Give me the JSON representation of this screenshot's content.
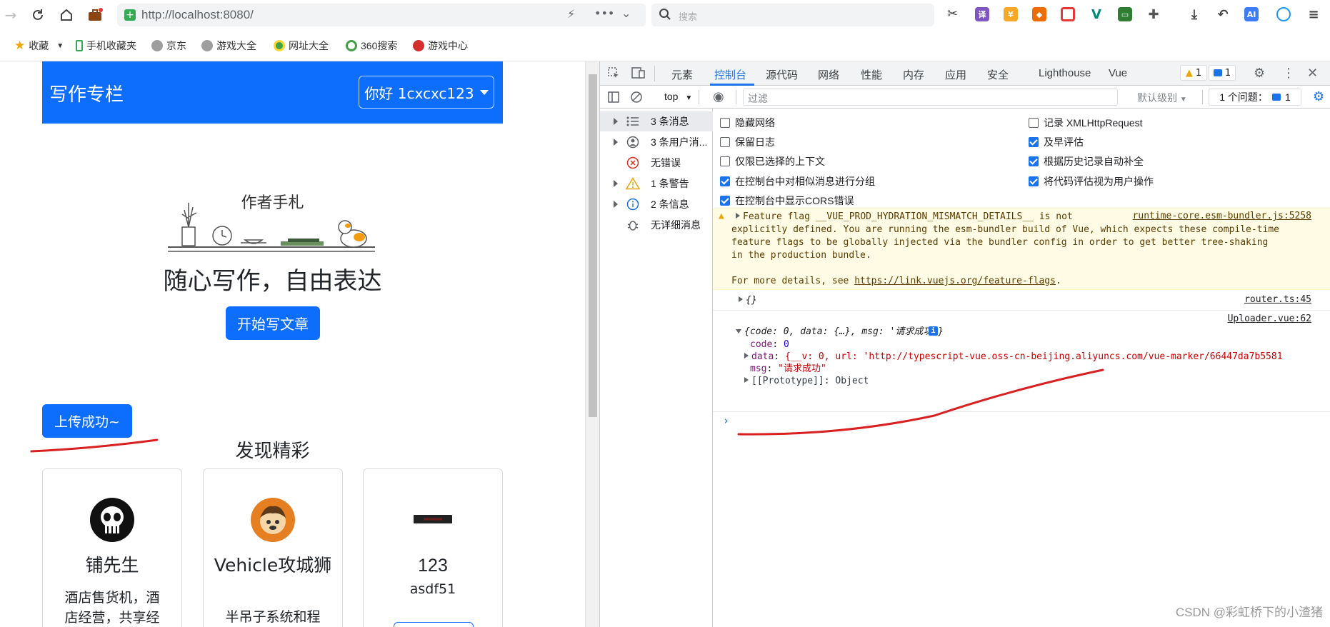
{
  "browser": {
    "url": "http://localhost:8080/",
    "search_placeholder": "搜索"
  },
  "bookmarks": [
    {
      "label": "收藏",
      "icon": "star-icon"
    },
    {
      "label": "手机收藏夹",
      "icon": "phone-icon"
    },
    {
      "label": "京东",
      "icon": "globe-icon"
    },
    {
      "label": "游戏大全",
      "icon": "globe-icon"
    },
    {
      "label": "网址大全",
      "icon": "web-icon"
    },
    {
      "label": "360搜索",
      "icon": "search-360-icon"
    },
    {
      "label": "游戏中心",
      "icon": "game-center-icon"
    }
  ],
  "page": {
    "brand": "写作专栏",
    "user_greeting": "你好 1cxcxc123",
    "hero_title": "作者手札",
    "hero_subtitle": "随心写作，自由表达",
    "start_button": "开始写文章",
    "upload_button": "上传成功~",
    "discover_title": "发现精彩",
    "cards": [
      {
        "name": "铺先生",
        "desc": "酒店售货机，酒店经营，共享经"
      },
      {
        "name": "Vehicle攻城狮",
        "desc": "半吊子系统和程"
      },
      {
        "name": "123",
        "desc": "asdf51"
      }
    ]
  },
  "devtools": {
    "tabs": [
      "元素",
      "控制台",
      "源代码",
      "网络",
      "性能",
      "内存",
      "应用",
      "安全",
      "Lighthouse",
      "Vue"
    ],
    "active_tab": "控制台",
    "warn_count": "1",
    "msg_count": "1",
    "context": "top",
    "filter_placeholder": "过滤",
    "level": "默认级别",
    "issues_label": "1 个问题：",
    "issues_count": "1",
    "sidebar": [
      {
        "label": "3 条消息",
        "icon": "list-icon"
      },
      {
        "label": "3 条用户消...",
        "icon": "user-icon"
      },
      {
        "label": "无错误",
        "icon": "error-icon"
      },
      {
        "label": "1 条警告",
        "icon": "warning-icon"
      },
      {
        "label": "2 条信息",
        "icon": "info-icon"
      },
      {
        "label": "无详细消息",
        "icon": "bug-icon"
      }
    ],
    "settings_left": [
      {
        "label": "隐藏网络",
        "checked": false
      },
      {
        "label": "保留日志",
        "checked": false
      },
      {
        "label": "仅限已选择的上下文",
        "checked": false
      },
      {
        "label": "在控制台中对相似消息进行分组",
        "checked": true
      },
      {
        "label": "在控制台中显示CORS错误",
        "checked": true
      }
    ],
    "settings_right": [
      {
        "label": "记录 XMLHttpRequest",
        "checked": false
      },
      {
        "label": "及早评估",
        "checked": true
      },
      {
        "label": "根据历史记录自动补全",
        "checked": true
      },
      {
        "label": "将代码评估视为用户操作",
        "checked": true
      }
    ],
    "console": {
      "warning_lines": [
        "Feature flag __VUE_PROD_HYDRATION_MISMATCH_DETAILS__ is not",
        "explicitly defined. You are running the esm-bundler build of Vue, which expects these compile-time",
        "feature flags to be globally injected via the bundler config in order to get better tree-shaking",
        "in the production bundle."
      ],
      "warning_more_prefix": "For more details, see ",
      "warning_link": "https://link.vuejs.org/feature-flags",
      "warning_source": "runtime-core.esm-bundler.js:5258",
      "log1_text": "{}",
      "log1_source": "router.ts:45",
      "log2_source": "Uploader.vue:62",
      "log2_summary": "{code: 0, data: {…}, msg: '请求成功'}",
      "log2_code_key": "code",
      "log2_code_val": "0",
      "log2_data_key": "data",
      "log2_data_val": "{__v: 0, url: 'http://typescript-vue.oss-cn-beijing.aliyuncs.com/vue-marker/66447da7b5581",
      "log2_msg_key": "msg",
      "log2_msg_val": "\"请求成功\"",
      "log2_proto": "[[Prototype]]: Object"
    }
  },
  "watermark": "CSDN @彩虹桥下的小渣猪",
  "colors": {
    "primary": "#0d6efd",
    "devtools_accent": "#1a73e8",
    "annotation": "#d92020"
  }
}
